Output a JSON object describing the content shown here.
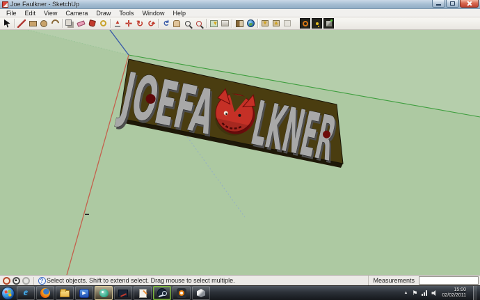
{
  "window": {
    "title": "Joe Faulkner - SketchUp",
    "controls": [
      "minimize",
      "maximize",
      "close"
    ]
  },
  "menu": {
    "items": [
      "File",
      "Edit",
      "View",
      "Camera",
      "Draw",
      "Tools",
      "Window",
      "Help"
    ]
  },
  "toolbar": {
    "icons": [
      "select",
      "line",
      "rectangle",
      "circle",
      "arc",
      "make-component",
      "eraser",
      "paint-bucket",
      "tape-measure",
      "push-pull",
      "move",
      "rotate",
      "offset",
      "orbit",
      "pan",
      "zoom",
      "zoom-extents",
      "add-location",
      "toggle-terrain",
      "photo-textures",
      "preview-in-google-earth",
      "get-models",
      "share-model",
      "share-component",
      "extension-1",
      "extension-2",
      "extension-3"
    ],
    "glyphs": {
      "arrow_up": "▲",
      "arrow_down": "▼",
      "rotate": "↻",
      "offset": "↺",
      "orbit": "↻",
      "pin": "▼",
      "play": "▶",
      "ie_e": "e"
    }
  },
  "viewport": {
    "background_color": "#ADC9A2",
    "sign": {
      "part1": "JOEFA",
      "part2": "LKNER",
      "board_color": "#4A3D10",
      "letter_color": "#A8A8A8",
      "face_color": "#C53026"
    },
    "axes": {
      "red": "#C4614D",
      "green": "#3E9E3E",
      "blue": "#3A5BA8"
    }
  },
  "statusbar": {
    "icons": [
      "model-info",
      "geo-location",
      "credits"
    ],
    "help_glyph": "?",
    "up_glyph": "▲",
    "hint": "Select objects. Shift to extend select. Drag mouse to select multiple.",
    "measurements_label": "Measurements",
    "measurements_value": ""
  },
  "taskbar": {
    "apps": [
      "start",
      "internet-explorer",
      "firefox",
      "windows-explorer",
      "media-player",
      "active-app",
      "graphics-app",
      "notes-app",
      "steam",
      "blender",
      "unity"
    ],
    "tray": [
      "show-hidden",
      "action-center-flag",
      "network",
      "volume"
    ],
    "chevron_glyph": "▲",
    "flag_glyph": "⚑",
    "clock": {
      "time": "15:00",
      "date": "02/02/2011"
    }
  }
}
